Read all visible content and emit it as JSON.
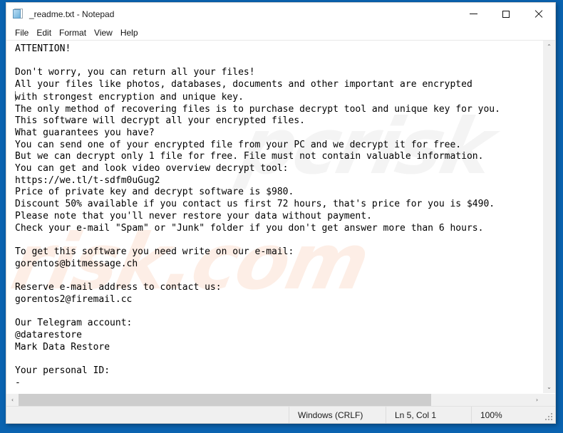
{
  "window": {
    "title": "_readme.txt - Notepad",
    "icon": "notepad-document-icon",
    "controls": {
      "minimize": "–",
      "maximize": "□",
      "close": "✕"
    }
  },
  "menubar": {
    "items": [
      {
        "label": "File"
      },
      {
        "label": "Edit"
      },
      {
        "label": "Format"
      },
      {
        "label": "View"
      },
      {
        "label": "Help"
      }
    ]
  },
  "document": {
    "filename": "_readme.txt",
    "lines": [
      "ATTENTION!",
      "",
      "Don't worry, you can return all your files!",
      "All your files like photos, databases, documents and other important are encrypted",
      "with strongest encryption and unique key.",
      "The only method of recovering files is to purchase decrypt tool and unique key for you.",
      "This software will decrypt all your encrypted files.",
      "What guarantees you have?",
      "You can send one of your encrypted file from your PC and we decrypt it for free.",
      "But we can decrypt only 1 file for free. File must not contain valuable information.",
      "You can get and look video overview decrypt tool:",
      "https://we.tl/t-sdfm0uGug2",
      "Price of private key and decrypt software is $980.",
      "Discount 50% available if you contact us first 72 hours, that's price for you is $490.",
      "Please note that you'll never restore your data without payment.",
      "Check your e-mail \"Spam\" or \"Junk\" folder if you don't get answer more than 6 hours.",
      "",
      "To get this software you need write on our e-mail:",
      "gorentos@bitmessage.ch",
      "",
      "Reserve e-mail address to contact us:",
      "gorentos2@firemail.cc",
      "",
      "Our Telegram account:",
      "@datarestore",
      "Mark Data Restore",
      "",
      "Your personal ID:",
      "-"
    ],
    "text_before_caret": "ATTENTION!\n\nDon't worry, you can return all your files!\nAll your files like photos, databases, documents and other important are encrypted\n",
    "text_after_caret": "with strongest encryption and unique key.\nThe only method of recovering files is to purchase decrypt tool and unique key for you.\nThis software will decrypt all your encrypted files.\nWhat guarantees you have?\nYou can send one of your encrypted file from your PC and we decrypt it for free.\nBut we can decrypt only 1 file for free. File must not contain valuable information.\nYou can get and look video overview decrypt tool:\nhttps://we.tl/t-sdfm0uGug2\nPrice of private key and decrypt software is $980.\nDiscount 50% available if you contact us first 72 hours, that's price for you is $490.\nPlease note that you'll never restore your data without payment.\nCheck your e-mail \"Spam\" or \"Junk\" folder if you don't get answer more than 6 hours.\n\nTo get this software you need write on our e-mail:\ngorentos@bitmessage.ch\n\nReserve e-mail address to contact us:\ngorentos2@firemail.cc\n\nOur Telegram account:\n@datarestore\nMark Data Restore\n\nYour personal ID:\n-",
    "ransom": {
      "video_url": "https://we.tl/t-sdfm0uGug2",
      "price_full": "$980",
      "price_discount": "$490",
      "discount_percent": "50%",
      "discount_window": "72 hours",
      "response_time": "6 hours",
      "email_primary": "gorentos@bitmessage.ch",
      "email_reserve": "gorentos2@firemail.cc",
      "telegram": "@datarestore",
      "telegram_name": "Mark Data Restore",
      "personal_id": "-"
    }
  },
  "scrollbars": {
    "vertical": {
      "up_arrow": "⌃",
      "down_arrow": "⌄"
    },
    "horizontal": {
      "left_arrow": "‹",
      "right_arrow": "›",
      "thumb_fraction": "80%"
    }
  },
  "statusbar": {
    "line_ending": "Windows (CRLF)",
    "cursor_position": "Ln 5, Col 1",
    "zoom": "100%"
  },
  "watermark": {
    "text": "risk.com",
    "text_upper": "pcrisk",
    "color": "#fdeee6"
  },
  "colors": {
    "desktop": "#0a63b0",
    "window_bg": "#ffffff",
    "chrome": "#f0f0f0",
    "text": "#000000"
  }
}
